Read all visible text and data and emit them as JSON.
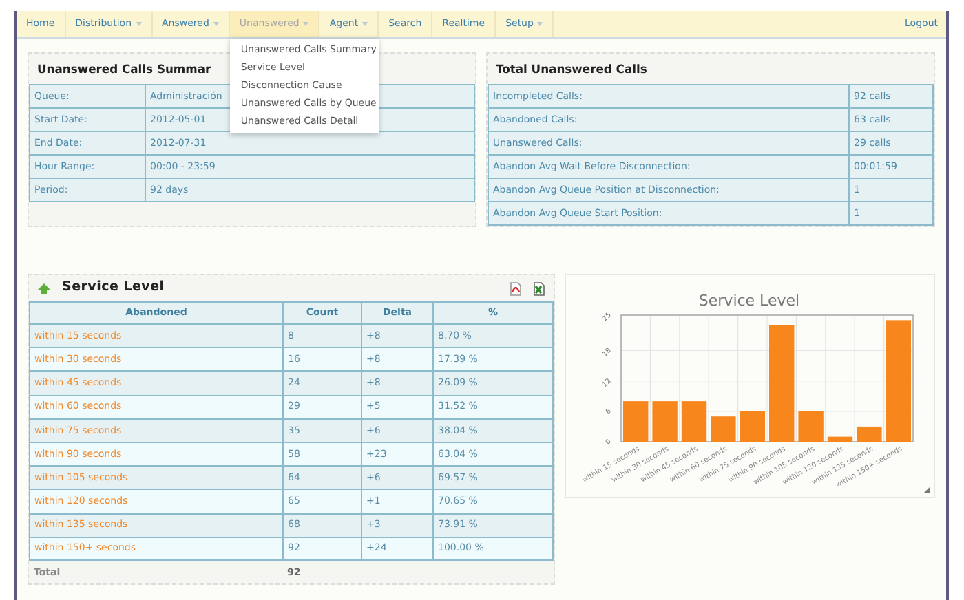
{
  "nav": {
    "items": [
      {
        "label": "Home",
        "dropdown": false,
        "selected": false
      },
      {
        "label": "Distribution",
        "dropdown": true,
        "selected": false
      },
      {
        "label": "Answered",
        "dropdown": true,
        "selected": false
      },
      {
        "label": "Unanswered",
        "dropdown": true,
        "selected": true
      },
      {
        "label": "Agent",
        "dropdown": true,
        "selected": false
      },
      {
        "label": "Search",
        "dropdown": false,
        "selected": false
      },
      {
        "label": "Realtime",
        "dropdown": false,
        "selected": false
      },
      {
        "label": "Setup",
        "dropdown": true,
        "selected": false
      }
    ],
    "logout": "Logout",
    "open_menu": [
      "Unanswered Calls Summary",
      "Service Level",
      "Disconnection Cause",
      "Unanswered Calls by Queue",
      "Unanswered Calls Detail"
    ]
  },
  "summary": {
    "title": "Unanswered Calls Summar",
    "rows": [
      {
        "label": "Queue:",
        "value": "Administración"
      },
      {
        "label": "Start Date:",
        "value": "2012-05-01"
      },
      {
        "label": "End Date:",
        "value": "2012-07-31"
      },
      {
        "label": "Hour Range:",
        "value": "00:00 - 23:59"
      },
      {
        "label": "Period:",
        "value": "92 days"
      }
    ]
  },
  "totals": {
    "title": "Total Unanswered Calls",
    "rows": [
      {
        "label": "Incompleted Calls:",
        "value": "92 calls"
      },
      {
        "label": "Abandoned Calls:",
        "value": "63 calls"
      },
      {
        "label": "Unanswered Calls:",
        "value": "29 calls"
      },
      {
        "label": "Abandon Avg Wait Before Disconnection:",
        "value": "00:01:59"
      },
      {
        "label": "Abandon Avg Queue Position at Disconnection:",
        "value": "1"
      },
      {
        "label": "Abandon Avg Queue Start Position:",
        "value": "1"
      }
    ]
  },
  "service_level": {
    "title": "Service Level",
    "columns": [
      "Abandoned",
      "Count",
      "Delta",
      "%"
    ],
    "rows": [
      [
        "within 15 seconds",
        "8",
        "+8",
        "8.70 %"
      ],
      [
        "within 30 seconds",
        "16",
        "+8",
        "17.39 %"
      ],
      [
        "within 45 seconds",
        "24",
        "+8",
        "26.09 %"
      ],
      [
        "within 60 seconds",
        "29",
        "+5",
        "31.52 %"
      ],
      [
        "within 75 seconds",
        "35",
        "+6",
        "38.04 %"
      ],
      [
        "within 90 seconds",
        "58",
        "+23",
        "63.04 %"
      ],
      [
        "within 105 seconds",
        "64",
        "+6",
        "69.57 %"
      ],
      [
        "within 120 seconds",
        "65",
        "+1",
        "70.65 %"
      ],
      [
        "within 135 seconds",
        "68",
        "+3",
        "73.91 %"
      ],
      [
        "within 150+ seconds",
        "92",
        "+24",
        "100.00 %"
      ]
    ],
    "total": {
      "label": "Total",
      "count": "92"
    }
  },
  "chart": {
    "chart_data": {
      "type": "bar",
      "title": "Service Level",
      "categories": [
        "within 15 seconds",
        "within 30 seconds",
        "within 45 seconds",
        "within 60 seconds",
        "within 75 seconds",
        "within 90 seconds",
        "within 105 seconds",
        "within 120 seconds",
        "within 135 seconds",
        "within 150+ seconds"
      ],
      "series": [
        {
          "color": "#f7861d",
          "values": [
            8,
            8,
            8,
            5,
            6,
            23,
            6,
            1,
            3,
            24
          ]
        }
      ],
      "grid": true,
      "ylim": [
        0,
        25
      ],
      "yticks": [
        0,
        6,
        12,
        18,
        25
      ]
    }
  }
}
